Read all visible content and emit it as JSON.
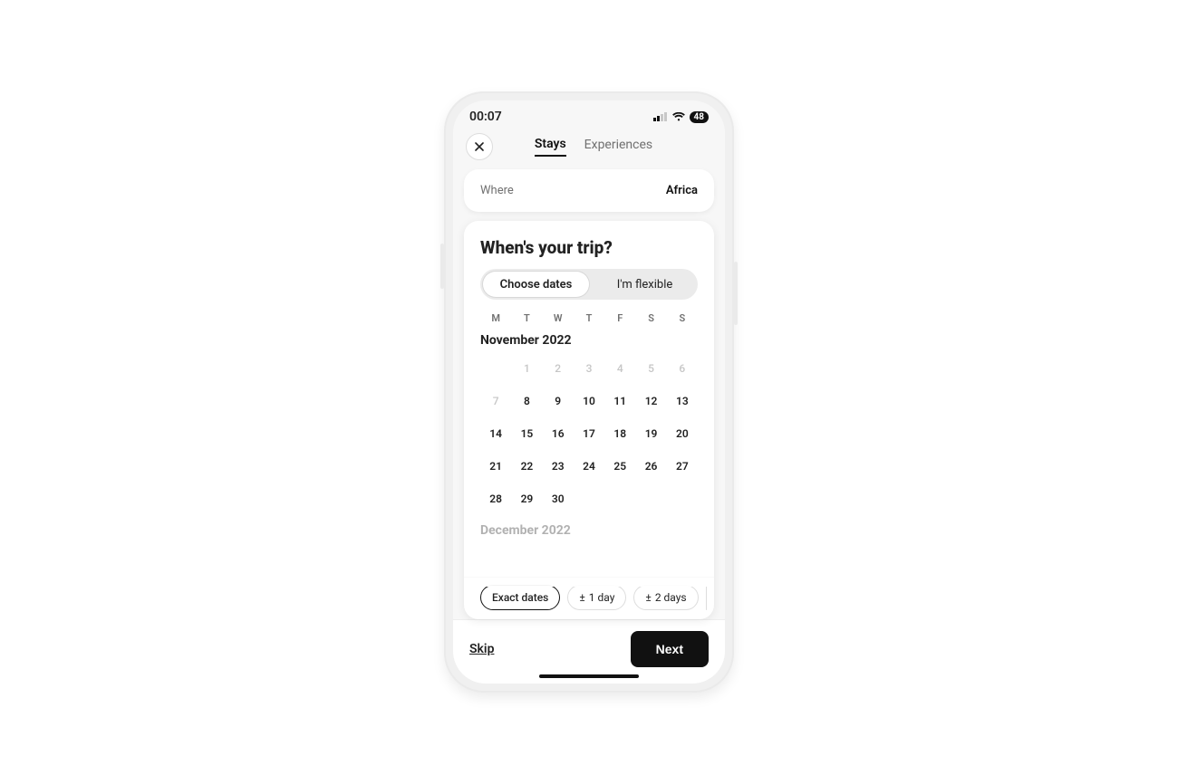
{
  "status": {
    "time": "00:07",
    "battery": "48"
  },
  "header": {
    "tabs": {
      "stays": "Stays",
      "experiences": "Experiences",
      "active": "stays"
    }
  },
  "where": {
    "label": "Where",
    "value": "Africa"
  },
  "when": {
    "title": "When's your trip?",
    "seg": {
      "choose": "Choose dates",
      "flexible": "I'm flexible",
      "active": "choose"
    },
    "weekdays": [
      "M",
      "T",
      "W",
      "T",
      "F",
      "S",
      "S"
    ],
    "month1": {
      "title": "November 2022",
      "offset": 1,
      "days": [
        {
          "n": 1,
          "past": true
        },
        {
          "n": 2,
          "past": true
        },
        {
          "n": 3,
          "past": true
        },
        {
          "n": 4,
          "past": true
        },
        {
          "n": 5,
          "past": true
        },
        {
          "n": 6,
          "past": true
        },
        {
          "n": 7,
          "past": true
        },
        {
          "n": 8
        },
        {
          "n": 9
        },
        {
          "n": 10
        },
        {
          "n": 11
        },
        {
          "n": 12
        },
        {
          "n": 13
        },
        {
          "n": 14
        },
        {
          "n": 15
        },
        {
          "n": 16
        },
        {
          "n": 17
        },
        {
          "n": 18
        },
        {
          "n": 19
        },
        {
          "n": 20
        },
        {
          "n": 21
        },
        {
          "n": 22
        },
        {
          "n": 23
        },
        {
          "n": 24
        },
        {
          "n": 25
        },
        {
          "n": 26
        },
        {
          "n": 27
        },
        {
          "n": 28
        },
        {
          "n": 29
        },
        {
          "n": 30
        }
      ]
    },
    "month2_peek": "December 2022",
    "flex_pills": {
      "exact": "Exact dates",
      "one": "1 day",
      "two": "2 days",
      "selected": "exact"
    }
  },
  "footer": {
    "skip": "Skip",
    "next": "Next"
  }
}
